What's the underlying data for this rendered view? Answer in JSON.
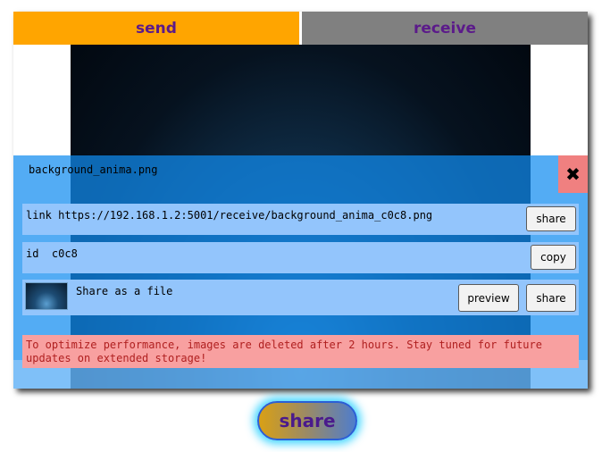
{
  "tabs": {
    "send": "send",
    "receive": "receive"
  },
  "panel": {
    "filename": "background_anima.png",
    "close_icon": "✖",
    "link_row": {
      "text": "link https://192.168.1.2:5001/receive/background_anima_c0c8.png",
      "share_label": "share"
    },
    "id_row": {
      "text": "id  c0c8",
      "copy_label": "copy"
    },
    "file_row": {
      "text": "Share as a file",
      "preview_label": "preview",
      "share_label": "share"
    },
    "notice": "To optimize performance, images are deleted after 2 hours. Stay tuned for future updates on extended storage!"
  },
  "share_button": "share",
  "colors": {
    "send_tab": "#ffa500",
    "receive_tab": "#808080",
    "tab_text": "#5b1a8a",
    "row_bg": "#93c5fc",
    "notice_bg": "#f8a0a0",
    "notice_text": "#b02020",
    "close_bg": "#f08080"
  }
}
